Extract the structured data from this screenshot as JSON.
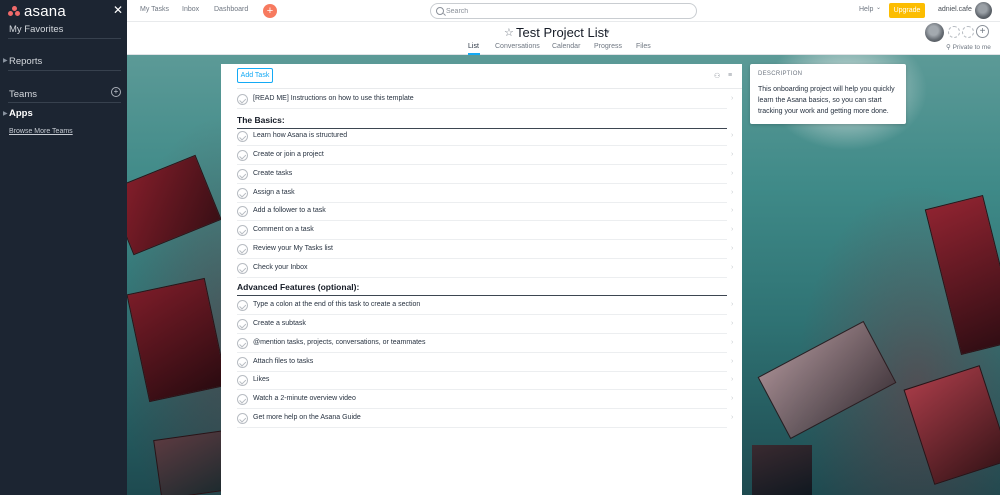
{
  "sidebar": {
    "logo_text": "asana",
    "close_icon": "close-icon",
    "favorites": "My Favorites",
    "reports": "Reports",
    "teams": "Teams",
    "apps": "Apps",
    "browse": "Browse More Teams"
  },
  "topbar": {
    "nav": [
      "My Tasks",
      "Inbox",
      "Dashboard"
    ],
    "quick_add": "+",
    "search_placeholder": "Search",
    "help": "Help",
    "upgrade": "Upgrade",
    "username": "adniel.cafe"
  },
  "project": {
    "title": "Test Project List",
    "tabs": [
      "List",
      "Conversations",
      "Calendar",
      "Progress",
      "Files"
    ],
    "active_tab": "List",
    "privacy": "Private to me"
  },
  "tasks": {
    "add_task": "Add Task",
    "intro": "[READ ME] Instructions on how to use this template",
    "basics_header": "The Basics:",
    "basics": [
      "Learn how Asana is structured",
      "Create or join a project",
      "Create tasks",
      "Assign a task",
      "Add a follower to a task",
      "Comment on a task",
      "Review your My Tasks list",
      "Check your Inbox"
    ],
    "advanced_header": "Advanced Features (optional):",
    "advanced": [
      "Type a colon at the end of this task to create a section",
      "Create a subtask",
      "@mention tasks, projects, conversations, or teammates",
      "Attach files to tasks",
      "Likes",
      "Watch a 2-minute overview video",
      "Get more help on the Asana Guide"
    ]
  },
  "description": {
    "title": "DESCRIPTION",
    "text": "This onboarding project will help you quickly learn the Asana basics, so you can start tracking your work and getting more done."
  },
  "colors": {
    "accent": "#14aaf5",
    "upgrade": "#fcbd01",
    "sidebar": "#1c2532",
    "quick_add": "#f77a5f"
  }
}
